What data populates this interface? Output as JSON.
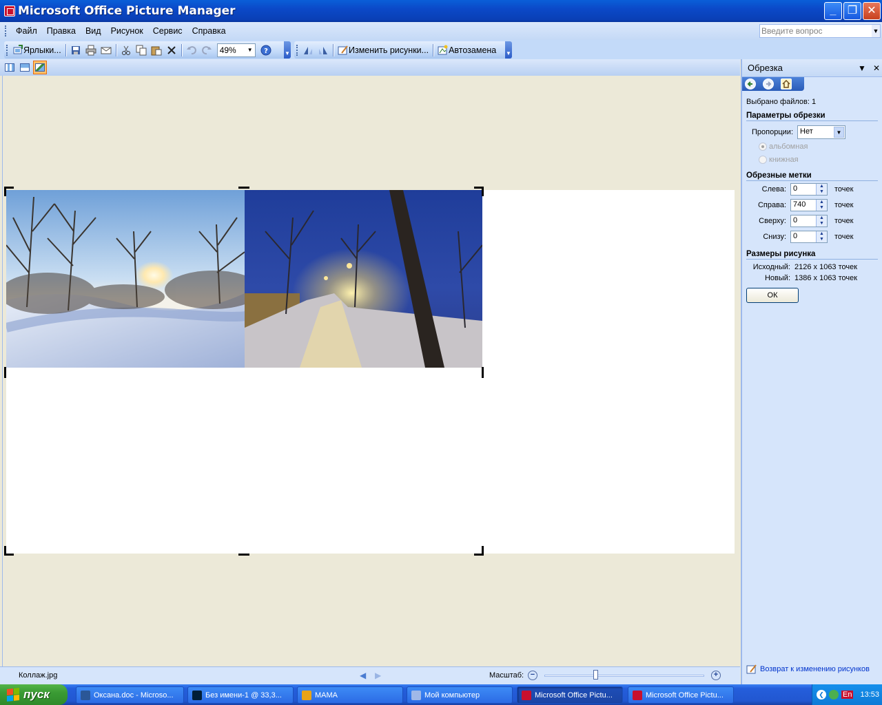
{
  "window": {
    "title": "Microsoft Office Picture Manager",
    "btn_minimize": "_",
    "btn_maximize": "❐",
    "btn_close": "✕"
  },
  "menu": {
    "items": [
      "Файл",
      "Правка",
      "Вид",
      "Рисунок",
      "Сервис",
      "Справка"
    ],
    "ask_placeholder": "Введите вопрос"
  },
  "toolbar": {
    "shortcuts_label": "Ярлыки...",
    "zoom_value": "49%",
    "edit_pictures_label": "Изменить рисунки...",
    "autocorrect_label": "Автозамена"
  },
  "taskpane": {
    "title": "Обрезка",
    "files_selected": "Выбрано файлов: 1",
    "crop_params_heading": "Параметры обрезки",
    "aspect_label": "Пропорции:",
    "aspect_value": "Нет",
    "orientation_landscape": "альбомная",
    "orientation_portrait": "книжная",
    "crop_handles_heading": "Обрезные метки",
    "fields": [
      {
        "label": "Слева:",
        "value": "0",
        "unit": "точек"
      },
      {
        "label": "Справа:",
        "value": "740",
        "unit": "точек"
      },
      {
        "label": "Сверху:",
        "value": "0",
        "unit": "точек"
      },
      {
        "label": "Снизу:",
        "value": "0",
        "unit": "точек"
      }
    ],
    "size_heading": "Размеры рисунка",
    "original_label": "Исходный:",
    "original_value": "2126 x 1063 точек",
    "new_label": "Новый:",
    "new_value": "1386 x 1063 точек",
    "ok_label": "ОК",
    "back_link": "Возврат к изменению рисунков"
  },
  "statusbar": {
    "filename": "Коллаж.jpg",
    "zoom_label": "Масштаб:",
    "zoom_slider_fraction": 0.32
  },
  "taskbar": {
    "start_label": "пуск",
    "tasks": [
      {
        "label": "Оксана.doc - Microsо...",
        "color": "#2b5797"
      },
      {
        "label": "Без имени-1 @ 33,3...",
        "color": "#001e36"
      },
      {
        "label": "МАМА",
        "color": "#e8a317"
      },
      {
        "label": "Мой компьютер",
        "color": "#9fb8e8"
      },
      {
        "label": "Microsoft Office Pictu...",
        "color": "#c8102e"
      },
      {
        "label": "Microsoft Office Pictu...",
        "color": "#c8102e"
      }
    ],
    "lang": "En",
    "clock": "13:53"
  },
  "colors": {
    "accent": "#0a5fd8",
    "pane": "#d6e5fb",
    "canvas": "#ece9d8"
  }
}
